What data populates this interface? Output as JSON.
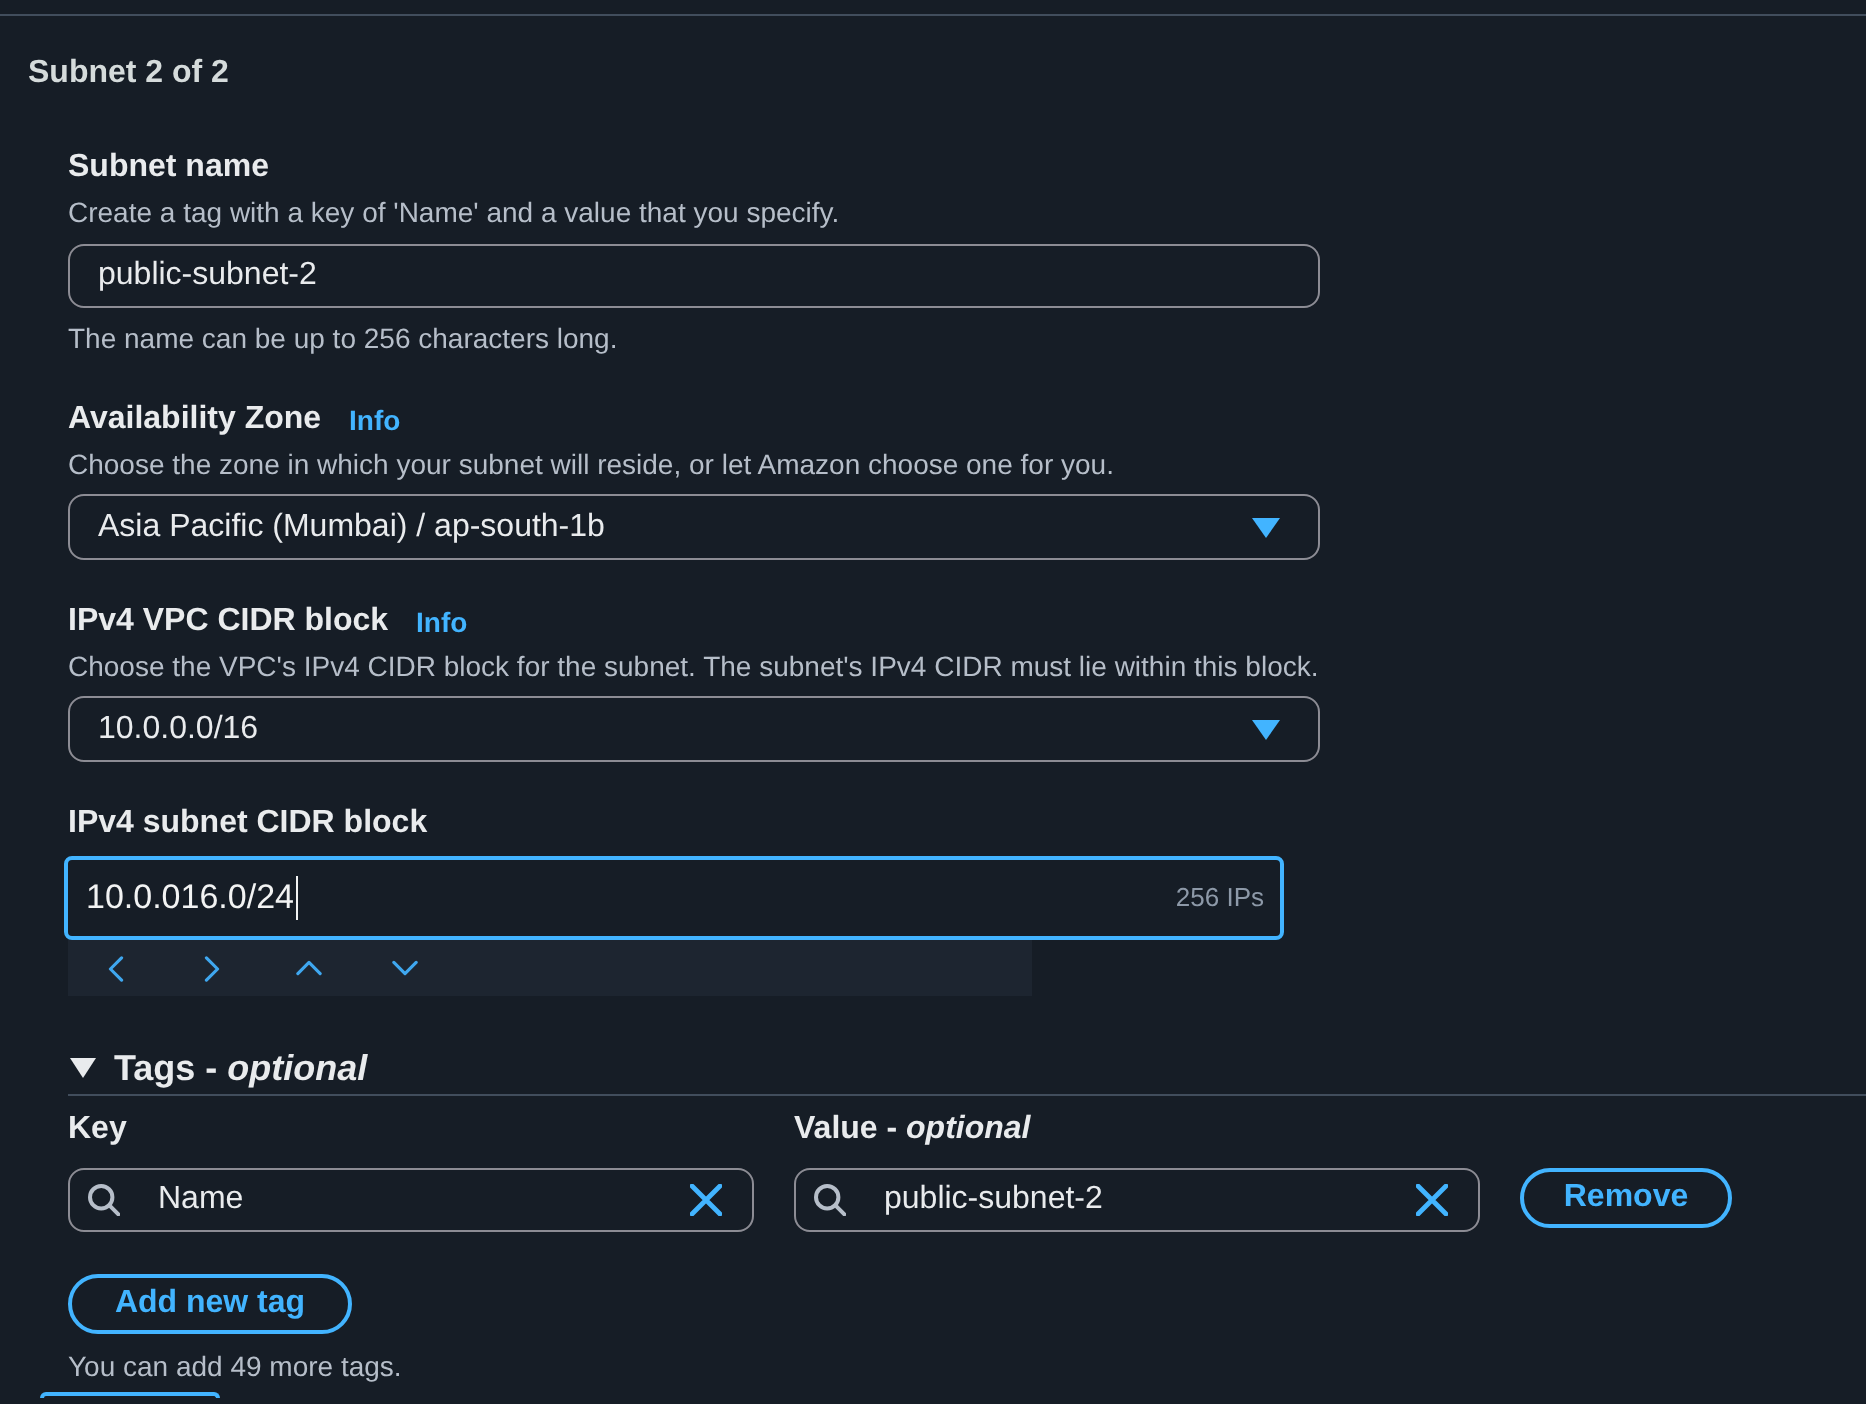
{
  "section": {
    "title": "Subnet 2 of 2"
  },
  "fields": [
    {
      "kind": "text",
      "label": "Subnet name",
      "description": "Create a tag with a key of 'Name' and a value that you specify.",
      "value": "public-subnet-2",
      "hint": "The name can be up to 256 characters long."
    },
    {
      "kind": "select",
      "label": "Availability Zone",
      "info": "Info",
      "description": "Choose the zone in which your subnet will reside, or let Amazon choose one for you.",
      "value": "Asia Pacific (Mumbai) / ap-south-1b"
    },
    {
      "kind": "select",
      "label": "IPv4 VPC CIDR block",
      "info": "Info",
      "description": "Choose the VPC's IPv4 CIDR block for the subnet. The subnet's IPv4 CIDR must lie within this block.",
      "value": "10.0.0.0/16"
    },
    {
      "kind": "cidr",
      "label": "IPv4 subnet CIDR block",
      "value": "10.0.016.0/24",
      "suffix": "256 IPs",
      "focused": true
    }
  ],
  "tags": {
    "title": "Tags - *optional*",
    "expanded": true,
    "key_label": "Key",
    "value_label": "Value - *optional*",
    "rows": [
      {
        "key": "Name",
        "value": "public-subnet-2",
        "remove": "Remove"
      }
    ],
    "add_button": "Add new tag",
    "note": "You can add 49 more tags."
  }
}
